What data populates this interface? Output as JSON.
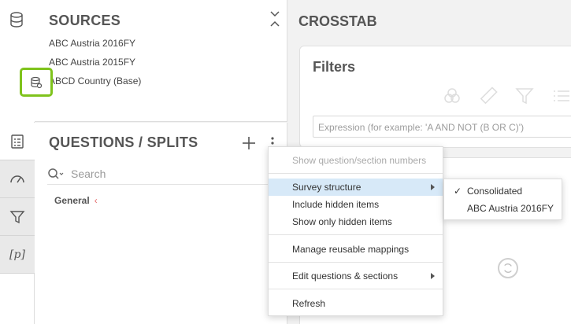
{
  "sources": {
    "title": "SOURCES",
    "items": [
      "ABC Austria 2016FY",
      "ABC Austria 2015FY",
      "ABCD Country (Base)"
    ]
  },
  "questions": {
    "title": "QUESTIONS / SPLITS",
    "search_placeholder": "Search",
    "tree": [
      {
        "label": "General",
        "chevron": "‹"
      }
    ]
  },
  "crosstab": {
    "title": "CROSSTAB",
    "filters_title": "Filters",
    "expression_placeholder": "Expression (for example: 'A AND NOT (B OR C)')"
  },
  "context_menu": {
    "items": [
      {
        "label": "Show question/section numbers",
        "disabled": true
      },
      {
        "label": "Survey structure",
        "submenu": true,
        "active": true
      },
      {
        "label": "Include hidden items"
      },
      {
        "label": "Show only hidden items"
      },
      {
        "label": "Manage reusable mappings"
      },
      {
        "label": "Edit questions & sections",
        "submenu": true
      },
      {
        "label": "Refresh"
      }
    ]
  },
  "submenu": {
    "items": [
      {
        "label": "Consolidated",
        "checked": true,
        "check_glyph": "✓"
      },
      {
        "label": "ABC Austria 2016FY",
        "checked": false
      }
    ]
  },
  "rail": {
    "icons": [
      "database-icon",
      "checklist-icon",
      "gauge-icon",
      "filter-icon",
      "variable-icon"
    ],
    "variable_label": "[p]"
  },
  "colors": {
    "accent_green": "#7fc31c",
    "menu_highlight": "#d7e9f8",
    "chevron_red": "#e46a6a"
  }
}
